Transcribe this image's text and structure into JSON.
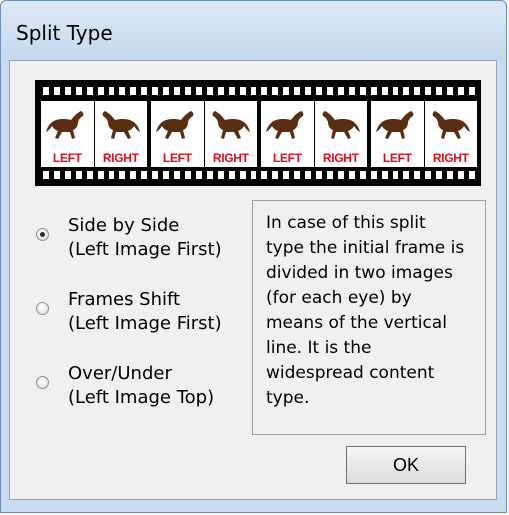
{
  "window": {
    "title": "Split Type"
  },
  "filmstrip": {
    "frames": [
      {
        "label": "LEFT"
      },
      {
        "label": "RIGHT"
      },
      {
        "label": "LEFT"
      },
      {
        "label": "RIGHT"
      },
      {
        "label": "LEFT"
      },
      {
        "label": "RIGHT"
      },
      {
        "label": "LEFT"
      },
      {
        "label": "RIGHT"
      }
    ],
    "icon": "horse-icon"
  },
  "options": [
    {
      "line1": "Side by Side",
      "line2": "(Left Image First)",
      "checked": true
    },
    {
      "line1": "Frames Shift",
      "line2": "(Left Image First)",
      "checked": false
    },
    {
      "line1": "Over/Under",
      "line2": "(Left Image Top)",
      "checked": false
    }
  ],
  "description": {
    "lines": [
      "In case of this split",
      "type the initial frame is",
      "divided in two images",
      "(for each eye) by",
      "means of the vertical",
      "line. It is the",
      "widespread content",
      "type."
    ]
  },
  "buttons": {
    "ok_label": "OK"
  },
  "colors": {
    "label_red": "#e30b17",
    "horse_brown": "#5a2e12"
  }
}
